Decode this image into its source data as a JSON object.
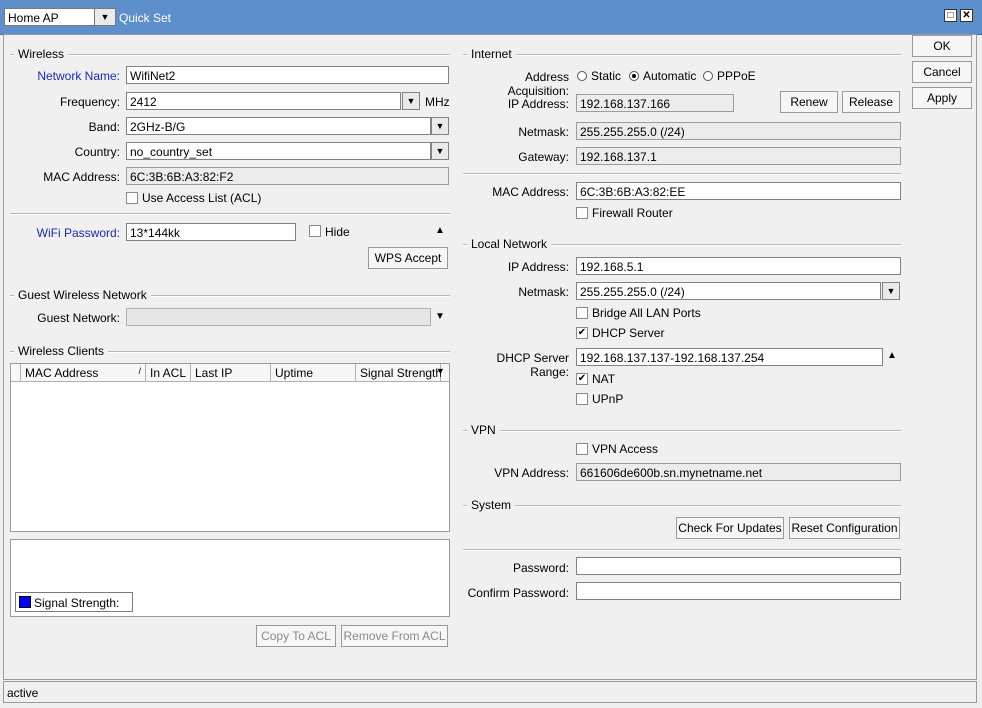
{
  "window": {
    "mode": "Home AP",
    "title": "Quick Set"
  },
  "actions": {
    "ok": "OK",
    "cancel": "Cancel",
    "apply": "Apply"
  },
  "wireless": {
    "section": "Wireless",
    "network_name_label": "Network Name:",
    "network_name": "WifiNet2",
    "frequency_label": "Frequency:",
    "frequency": "2412",
    "frequency_unit": "MHz",
    "band_label": "Band:",
    "band": "2GHz-B/G",
    "country_label": "Country:",
    "country": "no_country_set",
    "mac_label": "MAC Address:",
    "mac": "6C:3B:6B:A3:82:F2",
    "acl_label": "Use Access List (ACL)",
    "wifi_password_label": "WiFi Password:",
    "wifi_password": "13*144kk",
    "hide_label": "Hide",
    "wps_button": "WPS Accept"
  },
  "guest": {
    "section": "Guest Wireless Network",
    "network_label": "Guest Network:"
  },
  "clients": {
    "section": "Wireless Clients",
    "columns": [
      "MAC Address",
      "In ACL",
      "Last IP",
      "Uptime",
      "Signal Strength"
    ],
    "legend_label": "Signal Strength:",
    "legend_color": "#0000ff",
    "copy_button": "Copy To ACL",
    "remove_button": "Remove From ACL"
  },
  "internet": {
    "section": "Internet",
    "acq_label": "Address Acquisition:",
    "acq_options": [
      "Static",
      "Automatic",
      "PPPoE"
    ],
    "ip_label": "IP Address:",
    "ip": "192.168.137.166",
    "renew_button": "Renew",
    "release_button": "Release",
    "netmask_label": "Netmask:",
    "netmask": "255.255.255.0 (/24)",
    "gateway_label": "Gateway:",
    "gateway": "192.168.137.1",
    "mac_label": "MAC Address:",
    "mac": "6C:3B:6B:A3:82:EE",
    "firewall_label": "Firewall Router"
  },
  "local": {
    "section": "Local Network",
    "ip_label": "IP Address:",
    "ip": "192.168.5.1",
    "netmask_label": "Netmask:",
    "netmask": "255.255.255.0 (/24)",
    "bridge_label": "Bridge All LAN Ports",
    "dhcp_label": "DHCP Server",
    "range_label": "DHCP Server Range:",
    "range": "192.168.137.137-192.168.137.254",
    "nat_label": "NAT",
    "upnp_label": "UPnP"
  },
  "vpn": {
    "section": "VPN",
    "access_label": "VPN Access",
    "address_label": "VPN Address:",
    "address": "661606de600b.sn.mynetname.net"
  },
  "system": {
    "section": "System",
    "check_button": "Check For Updates",
    "reset_button": "Reset Configuration",
    "password_label": "Password:",
    "confirm_label": "Confirm Password:"
  },
  "status": {
    "text": "active"
  }
}
